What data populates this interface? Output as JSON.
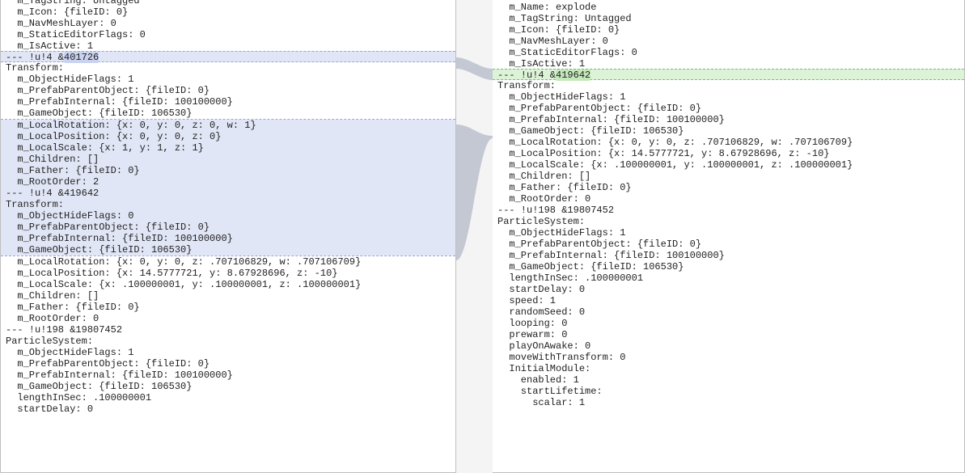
{
  "left": {
    "lines": [
      {
        "text": "  m_TagString: Untagged",
        "cls": ""
      },
      {
        "text": "  m_Icon: {fileID: 0}",
        "cls": ""
      },
      {
        "text": "  m_NavMeshLayer: 0",
        "cls": ""
      },
      {
        "text": "  m_StaticEditorFlags: 0",
        "cls": ""
      },
      {
        "text": "  m_IsActive: 1",
        "cls": ""
      },
      {
        "text": "--- !u!4 &401726",
        "cls": "hl-del",
        "strong": "401726"
      },
      {
        "text": "Transform:",
        "cls": ""
      },
      {
        "text": "  m_ObjectHideFlags: 1",
        "cls": ""
      },
      {
        "text": "  m_PrefabParentObject: {fileID: 0}",
        "cls": ""
      },
      {
        "text": "  m_PrefabInternal: {fileID: 100100000}",
        "cls": ""
      },
      {
        "text": "  m_GameObject: {fileID: 106530}",
        "cls": ""
      },
      {
        "text": "  m_LocalRotation: {x: 0, y: 0, z: 0, w: 1}",
        "cls": "blk-del-start"
      },
      {
        "text": "  m_LocalPosition: {x: 0, y: 0, z: 0}",
        "cls": "blk-del"
      },
      {
        "text": "  m_LocalScale: {x: 1, y: 1, z: 1}",
        "cls": "blk-del"
      },
      {
        "text": "  m_Children: []",
        "cls": "blk-del"
      },
      {
        "text": "  m_Father: {fileID: 0}",
        "cls": "blk-del"
      },
      {
        "text": "  m_RootOrder: 2",
        "cls": "blk-del"
      },
      {
        "text": "--- !u!4 &419642",
        "cls": "blk-del"
      },
      {
        "text": "Transform:",
        "cls": "blk-del"
      },
      {
        "text": "  m_ObjectHideFlags: 0",
        "cls": "blk-del"
      },
      {
        "text": "  m_PrefabParentObject: {fileID: 0}",
        "cls": "blk-del"
      },
      {
        "text": "  m_PrefabInternal: {fileID: 100100000}",
        "cls": "blk-del"
      },
      {
        "text": "  m_GameObject: {fileID: 106530}",
        "cls": "blk-del-end"
      },
      {
        "text": "  m_LocalRotation: {x: 0, y: 0, z: .707106829, w: .707106709}",
        "cls": ""
      },
      {
        "text": "  m_LocalPosition: {x: 14.5777721, y: 8.67928696, z: -10}",
        "cls": ""
      },
      {
        "text": "  m_LocalScale: {x: .100000001, y: .100000001, z: .100000001}",
        "cls": ""
      },
      {
        "text": "  m_Children: []",
        "cls": ""
      },
      {
        "text": "  m_Father: {fileID: 0}",
        "cls": ""
      },
      {
        "text": "  m_RootOrder: 0",
        "cls": ""
      },
      {
        "text": "--- !u!198 &19807452",
        "cls": ""
      },
      {
        "text": "ParticleSystem:",
        "cls": ""
      },
      {
        "text": "  m_ObjectHideFlags: 1",
        "cls": ""
      },
      {
        "text": "  m_PrefabParentObject: {fileID: 0}",
        "cls": ""
      },
      {
        "text": "  m_PrefabInternal: {fileID: 100100000}",
        "cls": ""
      },
      {
        "text": "  m_GameObject: {fileID: 106530}",
        "cls": ""
      },
      {
        "text": "  lengthInSec: .100000001",
        "cls": ""
      },
      {
        "text": "  startDelay: 0",
        "cls": ""
      }
    ]
  },
  "right": {
    "lines": [
      {
        "text": "  m_Name: explode",
        "cls": ""
      },
      {
        "text": "  m_TagString: Untagged",
        "cls": ""
      },
      {
        "text": "  m_Icon: {fileID: 0}",
        "cls": ""
      },
      {
        "text": "  m_NavMeshLayer: 0",
        "cls": ""
      },
      {
        "text": "  m_StaticEditorFlags: 0",
        "cls": ""
      },
      {
        "text": "  m_IsActive: 1",
        "cls": ""
      },
      {
        "text": "--- !u!4 &419642",
        "cls": "hl-add",
        "strong": "419642"
      },
      {
        "text": "Transform:",
        "cls": ""
      },
      {
        "text": "  m_ObjectHideFlags: 1",
        "cls": ""
      },
      {
        "text": "  m_PrefabParentObject: {fileID: 0}",
        "cls": ""
      },
      {
        "text": "  m_PrefabInternal: {fileID: 100100000}",
        "cls": ""
      },
      {
        "text": "  m_GameObject: {fileID: 106530}",
        "cls": ""
      },
      {
        "text": "  m_LocalRotation: {x: 0, y: 0, z: .707106829, w: .707106709}",
        "cls": ""
      },
      {
        "text": "  m_LocalPosition: {x: 14.5777721, y: 8.67928696, z: -10}",
        "cls": ""
      },
      {
        "text": "  m_LocalScale: {x: .100000001, y: .100000001, z: .100000001}",
        "cls": ""
      },
      {
        "text": "  m_Children: []",
        "cls": ""
      },
      {
        "text": "  m_Father: {fileID: 0}",
        "cls": ""
      },
      {
        "text": "  m_RootOrder: 0",
        "cls": ""
      },
      {
        "text": "--- !u!198 &19807452",
        "cls": ""
      },
      {
        "text": "ParticleSystem:",
        "cls": ""
      },
      {
        "text": "  m_ObjectHideFlags: 1",
        "cls": ""
      },
      {
        "text": "  m_PrefabParentObject: {fileID: 0}",
        "cls": ""
      },
      {
        "text": "  m_PrefabInternal: {fileID: 100100000}",
        "cls": ""
      },
      {
        "text": "  m_GameObject: {fileID: 106530}",
        "cls": ""
      },
      {
        "text": "  lengthInSec: .100000001",
        "cls": ""
      },
      {
        "text": "  startDelay: 0",
        "cls": ""
      },
      {
        "text": "  speed: 1",
        "cls": ""
      },
      {
        "text": "  randomSeed: 0",
        "cls": ""
      },
      {
        "text": "  looping: 0",
        "cls": ""
      },
      {
        "text": "  prewarm: 0",
        "cls": ""
      },
      {
        "text": "  playOnAwake: 0",
        "cls": ""
      },
      {
        "text": "  moveWithTransform: 0",
        "cls": ""
      },
      {
        "text": "  InitialModule:",
        "cls": ""
      },
      {
        "text": "    enabled: 1",
        "cls": ""
      },
      {
        "text": "    startLifetime:",
        "cls": ""
      },
      {
        "text": "      scalar: 1",
        "cls": ""
      }
    ]
  },
  "colors": {
    "del_bg": "#e1e6f6",
    "add_bg": "#ddf3d8",
    "gutter_bg": "#f4f4f4"
  }
}
